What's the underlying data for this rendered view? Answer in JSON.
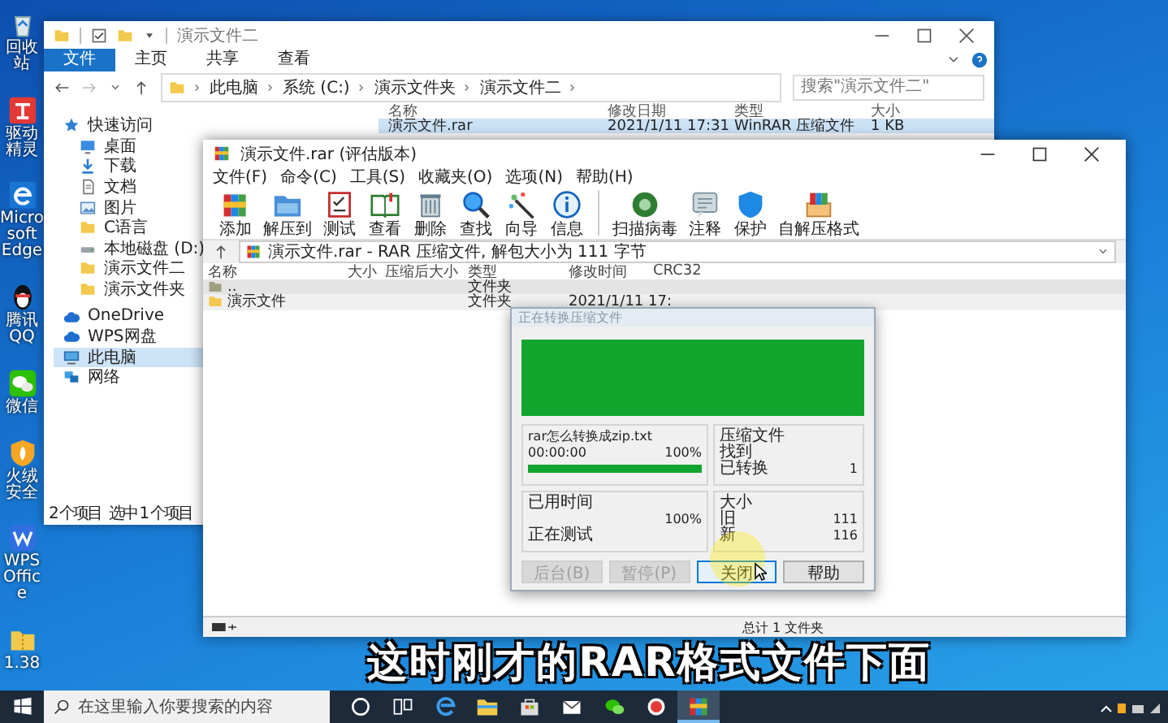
{
  "desktop_icons": [
    {
      "label": "回收站",
      "kind": "recycle"
    },
    {
      "label": "驱动精灵",
      "kind": "driver"
    },
    {
      "label": "Microsoft Edge",
      "kind": "edge"
    },
    {
      "label": "腾讯QQ",
      "kind": "qq"
    },
    {
      "label": "微信",
      "kind": "wechat"
    },
    {
      "label": "火绒安全",
      "kind": "shield"
    },
    {
      "label": "WPS Office",
      "kind": "wps"
    },
    {
      "label": "1.38",
      "kind": "folder"
    }
  ],
  "explorer": {
    "title": "演示文件二",
    "ribbon_tabs": [
      {
        "label": "文件",
        "selected": true
      },
      {
        "label": "主页",
        "selected": false
      },
      {
        "label": "共享",
        "selected": false
      },
      {
        "label": "查看",
        "selected": false
      }
    ],
    "breadcrumb": [
      "此电脑",
      "系统 (C:)",
      "演示文件夹",
      "演示文件二"
    ],
    "search": {
      "placeholder": "搜索\"演示文件二\""
    },
    "nav": [
      {
        "label": "快速访问",
        "kind": "star",
        "selected": false,
        "children": [
          {
            "label": "桌面",
            "kind": "desktop",
            "selected": false
          },
          {
            "label": "下载",
            "kind": "download",
            "selected": false
          },
          {
            "label": "文档",
            "kind": "doc",
            "selected": false
          },
          {
            "label": "图片",
            "kind": "picture",
            "selected": false
          },
          {
            "label": "C语言",
            "kind": "folder",
            "selected": false
          },
          {
            "label": "本地磁盘 (D:)",
            "kind": "drive",
            "selected": false
          },
          {
            "label": "演示文件二",
            "kind": "folder",
            "selected": false
          },
          {
            "label": "演示文件夹",
            "kind": "folder",
            "selected": false
          }
        ]
      },
      {
        "label": "OneDrive",
        "kind": "cloud",
        "selected": false
      },
      {
        "label": "WPS网盘",
        "kind": "cloud",
        "selected": false
      },
      {
        "label": "此电脑",
        "kind": "pc",
        "selected": true
      },
      {
        "label": "网络",
        "kind": "network",
        "selected": false
      }
    ],
    "columns": [
      "名称",
      "修改日期",
      "类型",
      "大小"
    ],
    "rows": [
      {
        "cells": [
          "演示文件.rar",
          "2021/1/11 17:31",
          "WinRAR 压缩文件",
          "1 KB"
        ],
        "selected": true
      }
    ],
    "status": [
      "2 个项目",
      "选中 1 个项目"
    ]
  },
  "winrar": {
    "title": "演示文件.rar (评估版本)",
    "menu": [
      "文件(F)",
      "命令(C)",
      "工具(S)",
      "收藏夹(O)",
      "选项(N)",
      "帮助(H)"
    ],
    "tool_groups": [
      [
        {
          "label": "添加",
          "kind": "add"
        },
        {
          "label": "解压到",
          "kind": "extract"
        },
        {
          "label": "测试",
          "kind": "test"
        },
        {
          "label": "查看",
          "kind": "view"
        },
        {
          "label": "删除",
          "kind": "delete"
        },
        {
          "label": "查找",
          "kind": "find"
        },
        {
          "label": "向导",
          "kind": "wizard"
        },
        {
          "label": "信息",
          "kind": "info"
        }
      ],
      [
        {
          "label": "扫描病毒",
          "kind": "scan"
        },
        {
          "label": "注释",
          "kind": "comment"
        },
        {
          "label": "保护",
          "kind": "protect"
        },
        {
          "label": "自解压格式",
          "kind": "sfx"
        }
      ]
    ],
    "path": "演示文件.rar - RAR 压缩文件, 解包大小为 111 字节",
    "columns": [
      "名称",
      "大小",
      "压缩后大小",
      "类型",
      "修改时间",
      "CRC32"
    ],
    "rows": [
      {
        "name": "..",
        "type": "文件夹",
        "kind": "parent"
      },
      {
        "name": "演示文件",
        "type": "文件夹",
        "modified": "2021/1/11 17:",
        "kind": "folder"
      }
    ],
    "status": "总计 1 文件夹"
  },
  "dialog": {
    "title": "正在转换压缩文件",
    "file": "rar怎么转换成zip.txt",
    "file_time": "00:00:00",
    "file_percent": "100%",
    "file_progress": {
      "level": 1
    },
    "elapsed_label": "已用时间",
    "total_percent": "100%",
    "operation": "正在测试",
    "archives_label": "压缩文件",
    "found_label": "找到",
    "converted_label": "已转换",
    "converted": "1",
    "size_label": "大小",
    "old_label": "旧",
    "old": "111",
    "new_label": "新",
    "new": "116",
    "buttons": [
      {
        "label": "后台(B)",
        "disabled": true,
        "focused": false
      },
      {
        "label": "暂停(P)",
        "disabled": true,
        "focused": false
      },
      {
        "label": "关闭",
        "disabled": false,
        "focused": true
      },
      {
        "label": "帮助",
        "disabled": false,
        "focused": false
      }
    ]
  },
  "subtitle": "这时刚才的RAR格式文件下面",
  "taskbar": {
    "search": {
      "placeholder": "在这里输入你要搜索的内容"
    },
    "apps": [
      {
        "kind": "cortana",
        "active": false
      },
      {
        "kind": "taskview",
        "active": false
      },
      {
        "kind": "edge",
        "active": false
      },
      {
        "kind": "explorer",
        "active": false
      },
      {
        "kind": "store",
        "active": false
      },
      {
        "kind": "mail",
        "active": false
      },
      {
        "kind": "wechat",
        "active": false
      },
      {
        "kind": "recorder",
        "active": false
      },
      {
        "kind": "winrar",
        "active": true
      }
    ]
  }
}
